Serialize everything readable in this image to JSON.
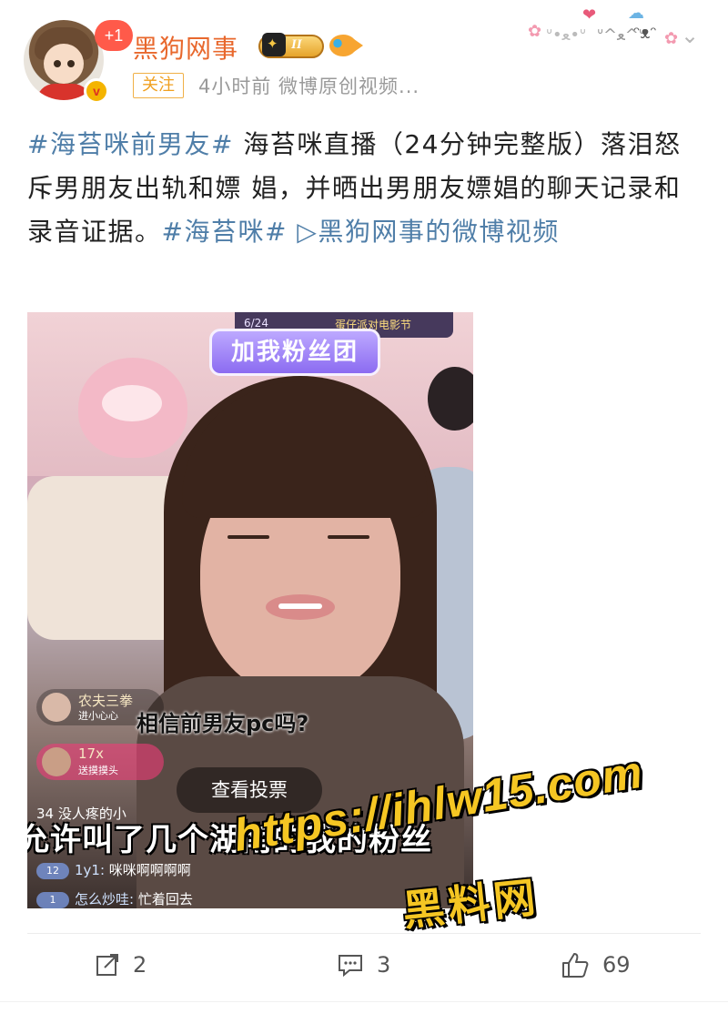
{
  "header": {
    "username": "黑狗网事",
    "notification_count": "+1",
    "verified_mark": "v",
    "vip_level": "II",
    "follow_label": "关注",
    "meta": "4小时前  微博原创视频..."
  },
  "post": {
    "tag1": "#海苔咪前男友#",
    "text1": " 海苔咪直播（24分钟完整版）落泪怒斥男朋友出轨和嫖 娼，并晒出男朋友嫖娼的聊天记录和录音证据。",
    "tag2": "#海苔咪#",
    "link": " ▷黑狗网事的微博视频"
  },
  "video": {
    "top_left_text": "6/24",
    "top_right_text": "蛋仔派对电影节",
    "fans_button": "加我粉丝团",
    "comment1_name": "农夫三拳",
    "comment1_sub": "进小心心",
    "comment2_name": "17x",
    "comment2_sub": "送摸摸头",
    "question": "相信前男友pc吗?",
    "vote_button": "查看投票",
    "small_chat": "34 没人疼的小",
    "subtitle": "允许叫了几个湖南的我的粉丝",
    "chat1_level": "12",
    "chat1_who": "1y1:",
    "chat1_text": " 咪咪啊啊啊啊",
    "chat2_level": "1",
    "chat2_who": "怎么炒哇:",
    "chat2_text": " 忙着回去"
  },
  "watermark": {
    "line1": "https://ihlw15.com",
    "line2": "黑料网"
  },
  "actions": {
    "repost_count": "2",
    "comment_count": "3",
    "like_count": "69"
  },
  "colors": {
    "username": "#e8682d",
    "link": "#4f7ea8",
    "follow": "#f0a020"
  }
}
